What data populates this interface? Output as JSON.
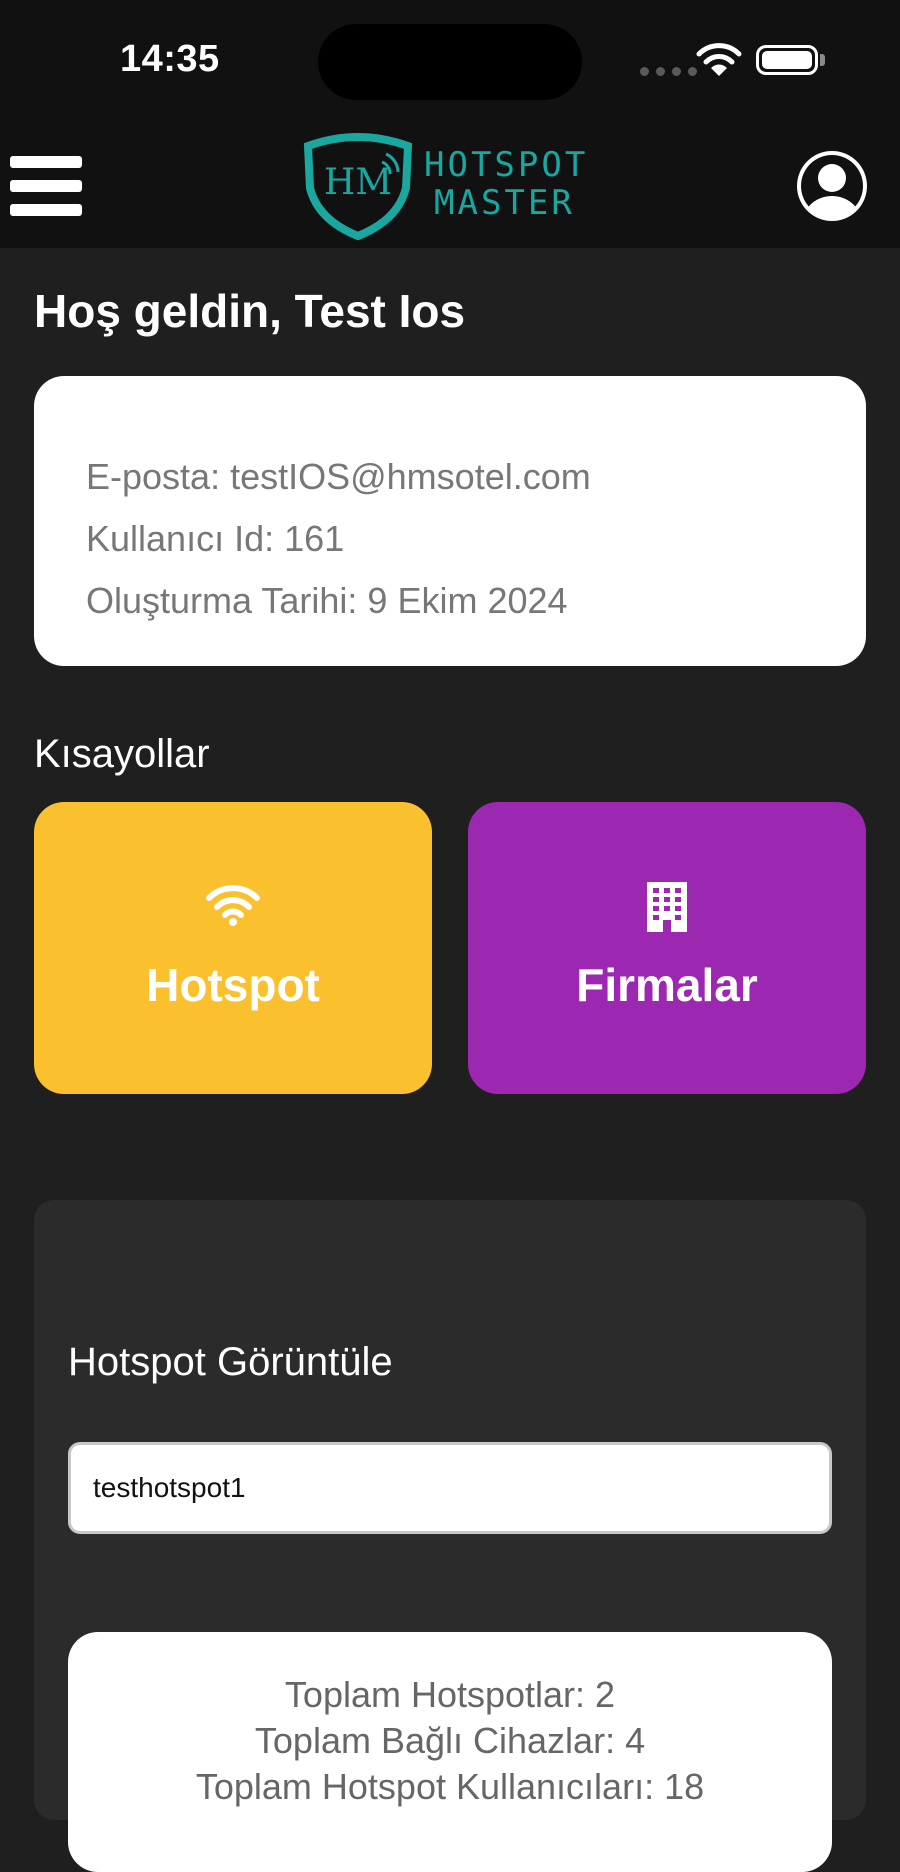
{
  "status_bar": {
    "time": "14:35"
  },
  "nav": {
    "logo_line1": "HOTSPOT",
    "logo_line2": "MASTER",
    "logo_monogram": "HM",
    "menu_icon": "hamburger-menu-icon",
    "profile_icon": "user-circle-icon"
  },
  "greeting": "Hoş geldin, Test Ios",
  "user_info": {
    "email": "E-posta: testIOS@hmsotel.com",
    "user_id": "Kullanıcı Id: 161",
    "created": "Oluşturma Tarihi: 9 Ekim 2024"
  },
  "shortcuts": {
    "title": "Kısayollar",
    "items": [
      {
        "label": "Hotspot",
        "icon": "wifi-icon",
        "color": "#fbc02d"
      },
      {
        "label": "Firmalar",
        "icon": "building-icon",
        "color": "#9c27b0"
      }
    ]
  },
  "hotspot_view": {
    "title": "Hotspot Görüntüle",
    "input_value": "testhotspot1",
    "stats": [
      "Toplam Hotspotlar: 2",
      "Toplam Bağlı Cihazlar: 4",
      "Toplam Hotspot Kullanıcıları: 18"
    ]
  },
  "colors": {
    "background": "#1f1f1f",
    "header": "#111111",
    "brand_teal": "#19a7a0"
  }
}
